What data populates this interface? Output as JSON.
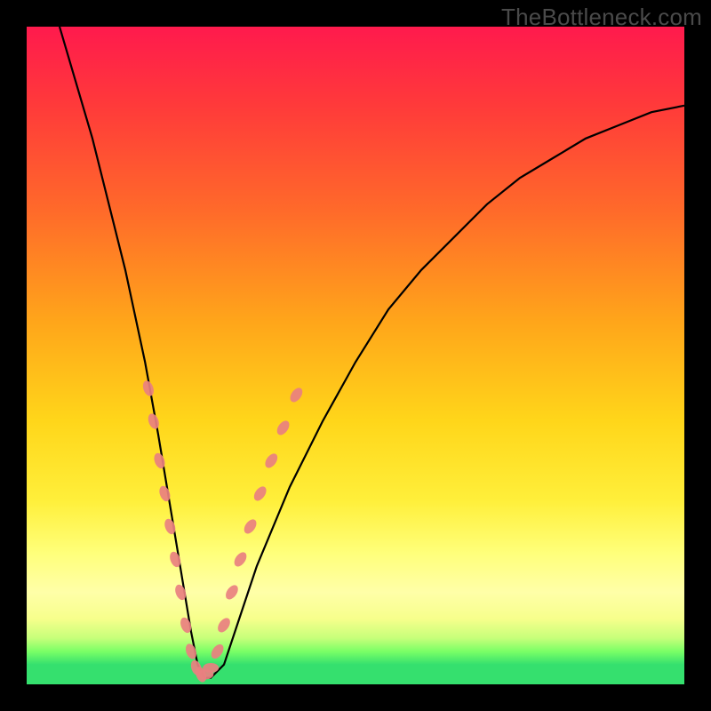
{
  "watermark": "TheBottleneck.com",
  "chart_data": {
    "type": "line",
    "title": "",
    "xlabel": "",
    "ylabel": "",
    "xlim": [
      0,
      100
    ],
    "ylim": [
      0,
      100
    ],
    "series": [
      {
        "name": "bottleneck-curve",
        "x": [
          5,
          10,
          15,
          18,
          20,
          22,
          24,
          25,
          26,
          27,
          28,
          30,
          32,
          35,
          40,
          45,
          50,
          55,
          60,
          65,
          70,
          75,
          80,
          85,
          90,
          95,
          100
        ],
        "y": [
          100,
          83,
          63,
          49,
          38,
          26,
          14,
          8,
          3,
          1,
          1,
          3,
          9,
          18,
          30,
          40,
          49,
          57,
          63,
          68,
          73,
          77,
          80,
          83,
          85,
          87,
          88
        ]
      }
    ],
    "markers": {
      "name": "highlight-dots",
      "color": "#e98080",
      "points": [
        {
          "x": 18.5,
          "y": 45
        },
        {
          "x": 19.3,
          "y": 40
        },
        {
          "x": 20.2,
          "y": 34
        },
        {
          "x": 21.0,
          "y": 29
        },
        {
          "x": 21.8,
          "y": 24
        },
        {
          "x": 22.6,
          "y": 19
        },
        {
          "x": 23.4,
          "y": 14
        },
        {
          "x": 24.2,
          "y": 9
        },
        {
          "x": 25.0,
          "y": 5
        },
        {
          "x": 25.8,
          "y": 2.5
        },
        {
          "x": 26.5,
          "y": 1.5
        },
        {
          "x": 27.2,
          "y": 1.5
        },
        {
          "x": 28.0,
          "y": 2.5
        },
        {
          "x": 29.0,
          "y": 5
        },
        {
          "x": 30.0,
          "y": 9
        },
        {
          "x": 31.2,
          "y": 14
        },
        {
          "x": 32.5,
          "y": 19
        },
        {
          "x": 34.0,
          "y": 24
        },
        {
          "x": 35.5,
          "y": 29
        },
        {
          "x": 37.2,
          "y": 34
        },
        {
          "x": 39.0,
          "y": 39
        },
        {
          "x": 41.0,
          "y": 44
        }
      ]
    }
  }
}
